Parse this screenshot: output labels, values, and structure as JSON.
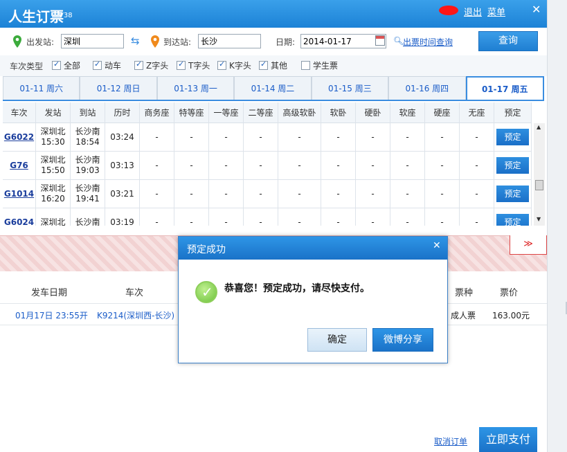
{
  "titlebar": {
    "app_name": "人生订票",
    "version": "V38",
    "logout": "退出",
    "menu": "菜单",
    "close": "✕"
  },
  "search": {
    "from_label": "出发站:",
    "from_value": "深圳",
    "to_label": "到达站:",
    "to_value": "长沙",
    "date_label": "日期:",
    "date_value": "2014-01-17",
    "time_query_link": "出票时间查询",
    "query_button": "查询"
  },
  "filters": {
    "label": "车次类型",
    "options": [
      {
        "label": "全部",
        "checked": true
      },
      {
        "label": "动车",
        "checked": true
      },
      {
        "label": "Z字头",
        "checked": true
      },
      {
        "label": "T字头",
        "checked": true
      },
      {
        "label": "K字头",
        "checked": true
      },
      {
        "label": "其他",
        "checked": true
      },
      {
        "label": "学生票",
        "checked": false
      }
    ]
  },
  "date_tabs": [
    {
      "label": "01-11  周六",
      "active": false
    },
    {
      "label": "01-12  周日",
      "active": false
    },
    {
      "label": "01-13  周一",
      "active": false
    },
    {
      "label": "01-14  周二",
      "active": false
    },
    {
      "label": "01-15  周三",
      "active": false
    },
    {
      "label": "01-16  周四",
      "active": false
    },
    {
      "label": "01-17  周五",
      "active": true
    }
  ],
  "train_table": {
    "columns": [
      "车次",
      "发站",
      "到站",
      "历时",
      "商务座",
      "特等座",
      "一等座",
      "二等座",
      "高级软卧",
      "软卧",
      "硬卧",
      "软座",
      "硬座",
      "无座",
      "预定"
    ],
    "rows": [
      {
        "train": "G6022",
        "from_station": "深圳北",
        "from_time": "15:30",
        "to_station": "长沙南",
        "to_time": "18:54",
        "duration": "03:24",
        "seats": [
          "-",
          "-",
          "-",
          "-",
          "-",
          "-",
          "-",
          "-",
          "-",
          "-"
        ],
        "book": "预定"
      },
      {
        "train": "G76",
        "from_station": "深圳北",
        "from_time": "15:50",
        "to_station": "长沙南",
        "to_time": "19:03",
        "duration": "03:13",
        "seats": [
          "-",
          "-",
          "-",
          "-",
          "-",
          "-",
          "-",
          "-",
          "-",
          "-"
        ],
        "book": "预定"
      },
      {
        "train": "G1014",
        "from_station": "深圳北",
        "from_time": "16:20",
        "to_station": "长沙南",
        "to_time": "19:41",
        "duration": "03:21",
        "seats": [
          "-",
          "-",
          "-",
          "-",
          "-",
          "-",
          "-",
          "-",
          "-",
          "-"
        ],
        "book": "预定"
      },
      {
        "train": "G6024",
        "from_station": "深圳北",
        "from_time": "",
        "to_station": "长沙南",
        "to_time": "",
        "duration": "03:19",
        "seats": [
          "-",
          "-",
          "-",
          "-",
          "-",
          "-",
          "-",
          "-",
          "-",
          "-"
        ],
        "book": "预定"
      }
    ]
  },
  "order_table": {
    "headers": {
      "date": "发车日期",
      "train": "车次",
      "ticket_type": "票种",
      "price": "票价"
    },
    "row": {
      "date": "01月17日 23:55开",
      "train": "K9214(深圳西-长沙)",
      "ticket_type": "成人票",
      "price": "163.00元"
    }
  },
  "band": {
    "collapse_icon": "≫"
  },
  "bottom": {
    "cancel_order": "取消订单",
    "pay_now": "立即支付"
  },
  "dialog": {
    "title": "预定成功",
    "close": "✕",
    "message": "恭喜您！预定成功，请尽快支付。",
    "ok": "确定",
    "share": "微博分享"
  },
  "colors": {
    "brand_blue": "#1c82d6",
    "link_blue": "#1a5cc8",
    "success_green": "#6cc13b"
  }
}
